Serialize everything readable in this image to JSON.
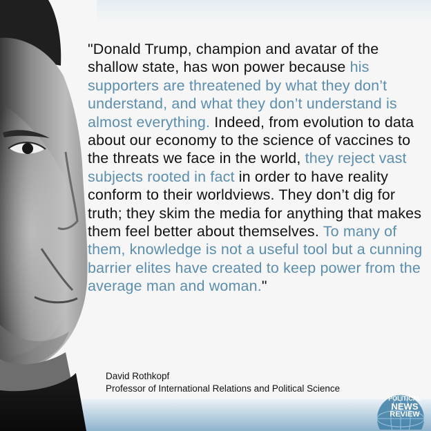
{
  "quote": {
    "segments": [
      {
        "text": "\"Donald Trump, champion and avatar of the shallow state, has won power because ",
        "highlight": false
      },
      {
        "text": "his supporters are threatened by what they don’t understand, and what they don’t understand is almost everything.",
        "highlight": true
      },
      {
        "text": " Indeed, from evolution to data about our economy to the science of vaccines to the threats we face in the world, ",
        "highlight": false
      },
      {
        "text": "they reject vast subjects rooted in fact",
        "highlight": true
      },
      {
        "text": " in order to have reality conform to their worldviews. They don’t dig for truth; they skim the media for anything that makes them feel better about themselves. ",
        "highlight": false
      },
      {
        "text": "To many of them, knowledge is not a useful tool but a cunning barrier elites have created to keep power from the average man and woman.",
        "highlight": true
      },
      {
        "text": "\"",
        "highlight": false
      }
    ]
  },
  "attribution": {
    "name": "David Rothkopf",
    "title": "Professor of International Relations and Political Science"
  },
  "logo": {
    "line1": "POLITICAL",
    "line2": "NEWS",
    "line3": "REVIEW"
  },
  "colors": {
    "highlight": "#5b8eae",
    "text": "#111111",
    "background": "#f6f6f6",
    "band": "#8fb3cd"
  }
}
